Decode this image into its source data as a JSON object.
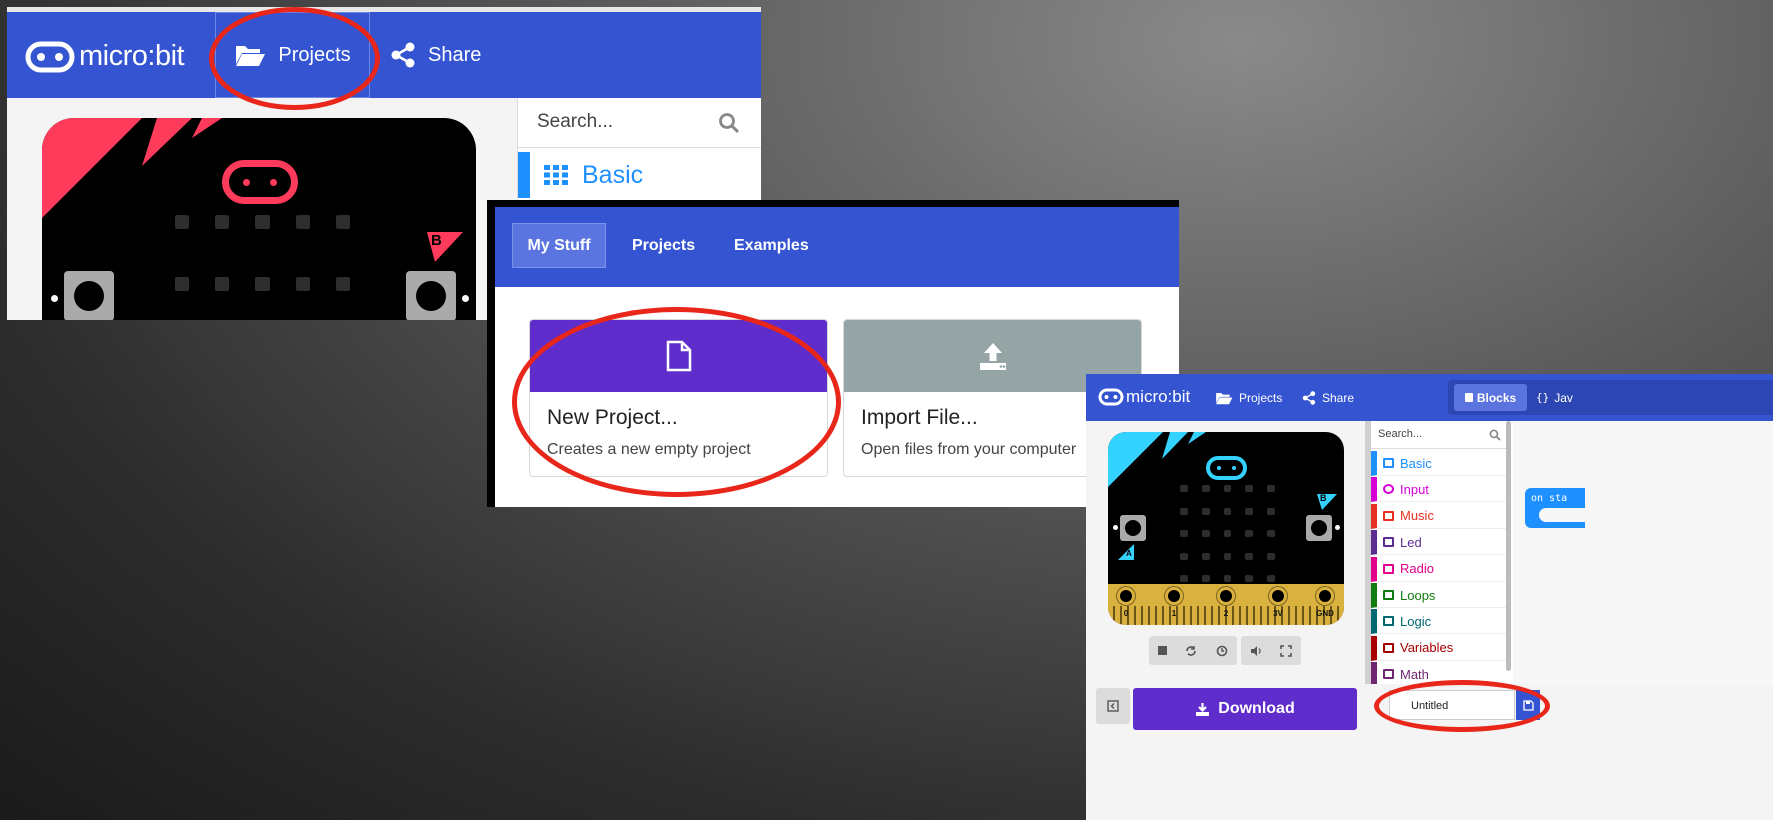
{
  "shot1": {
    "brand": "micro:bit",
    "projects_label": "Projects",
    "share_label": "Share",
    "search_placeholder": "Search...",
    "category_basic": "Basic",
    "button_b_label": "B"
  },
  "shot2": {
    "tabs": [
      "My Stuff",
      "Projects",
      "Examples"
    ],
    "new_project": {
      "title": "New Project...",
      "desc": "Creates a new empty project"
    },
    "import_file": {
      "title": "Import File...",
      "desc": "Open files from your computer"
    }
  },
  "shot3": {
    "brand": "micro:bit",
    "projects_label": "Projects",
    "share_label": "Share",
    "blocks_label": "Blocks",
    "js_label": "Jav",
    "search_placeholder": "Search...",
    "categories": [
      {
        "label": "Basic",
        "color": "#1e90ff"
      },
      {
        "label": "Input",
        "color": "#d400d4"
      },
      {
        "label": "Music",
        "color": "#e63022"
      },
      {
        "label": "Led",
        "color": "#5c2d91"
      },
      {
        "label": "Radio",
        "color": "#e3008c"
      },
      {
        "label": "Loops",
        "color": "#107c10"
      },
      {
        "label": "Logic",
        "color": "#006970"
      },
      {
        "label": "Variables",
        "color": "#a80000"
      },
      {
        "label": "Math",
        "color": "#712672"
      }
    ],
    "pins": [
      "0",
      "1",
      "2",
      "3V",
      "GND"
    ],
    "download_label": "Download",
    "project_name": "Untitled",
    "on_start_label": "on sta",
    "button_b_label": "B",
    "button_a_label": "A"
  },
  "colors": {
    "header": "#3454d1",
    "purple": "#5f2dcc",
    "ring": "#e8261a",
    "gold": "#d9b13e"
  }
}
